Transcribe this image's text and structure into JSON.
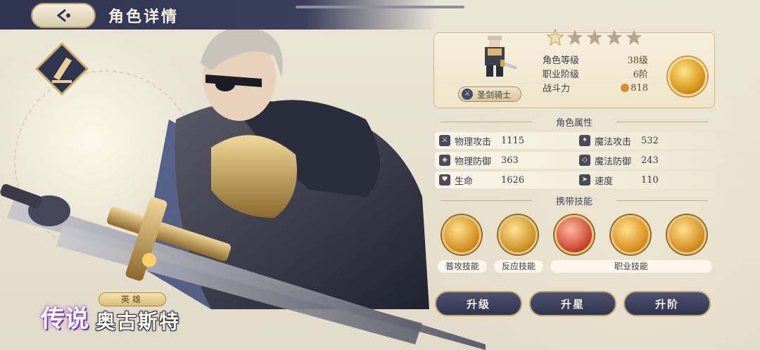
{
  "header": {
    "title": "角色详情",
    "back_icon": "back-arrow-icon"
  },
  "hero": {
    "rarity": "传说",
    "tag": "英雄",
    "name": "奥古斯特",
    "class_name": "圣剑骑士"
  },
  "info": {
    "stars_total": 5,
    "stars_filled": 1,
    "rows": [
      {
        "label": "角色等级",
        "value": "38级"
      },
      {
        "label": "职业阶级",
        "value": "6阶"
      },
      {
        "label": "战斗力",
        "value": "818"
      }
    ]
  },
  "attributes": {
    "title": "角色属性",
    "rows": [
      {
        "left_label": "物理攻击",
        "left_value": "1115",
        "right_label": "魔法攻击",
        "right_value": "532"
      },
      {
        "left_label": "物理防御",
        "left_value": "363",
        "right_label": "魔法防御",
        "right_value": "243"
      },
      {
        "left_label": "生命",
        "left_value": "1626",
        "right_label": "速度",
        "right_value": "110"
      }
    ]
  },
  "skills": {
    "title": "携带技能",
    "labels": {
      "normal": "普攻技能",
      "reaction": "反应技能",
      "job": "职业技能"
    }
  },
  "actions": {
    "level_up": "升级",
    "star_up": "升星",
    "rank_up": "升阶"
  },
  "colors": {
    "accent": "#3a405c",
    "gold": "#d9a44a"
  }
}
